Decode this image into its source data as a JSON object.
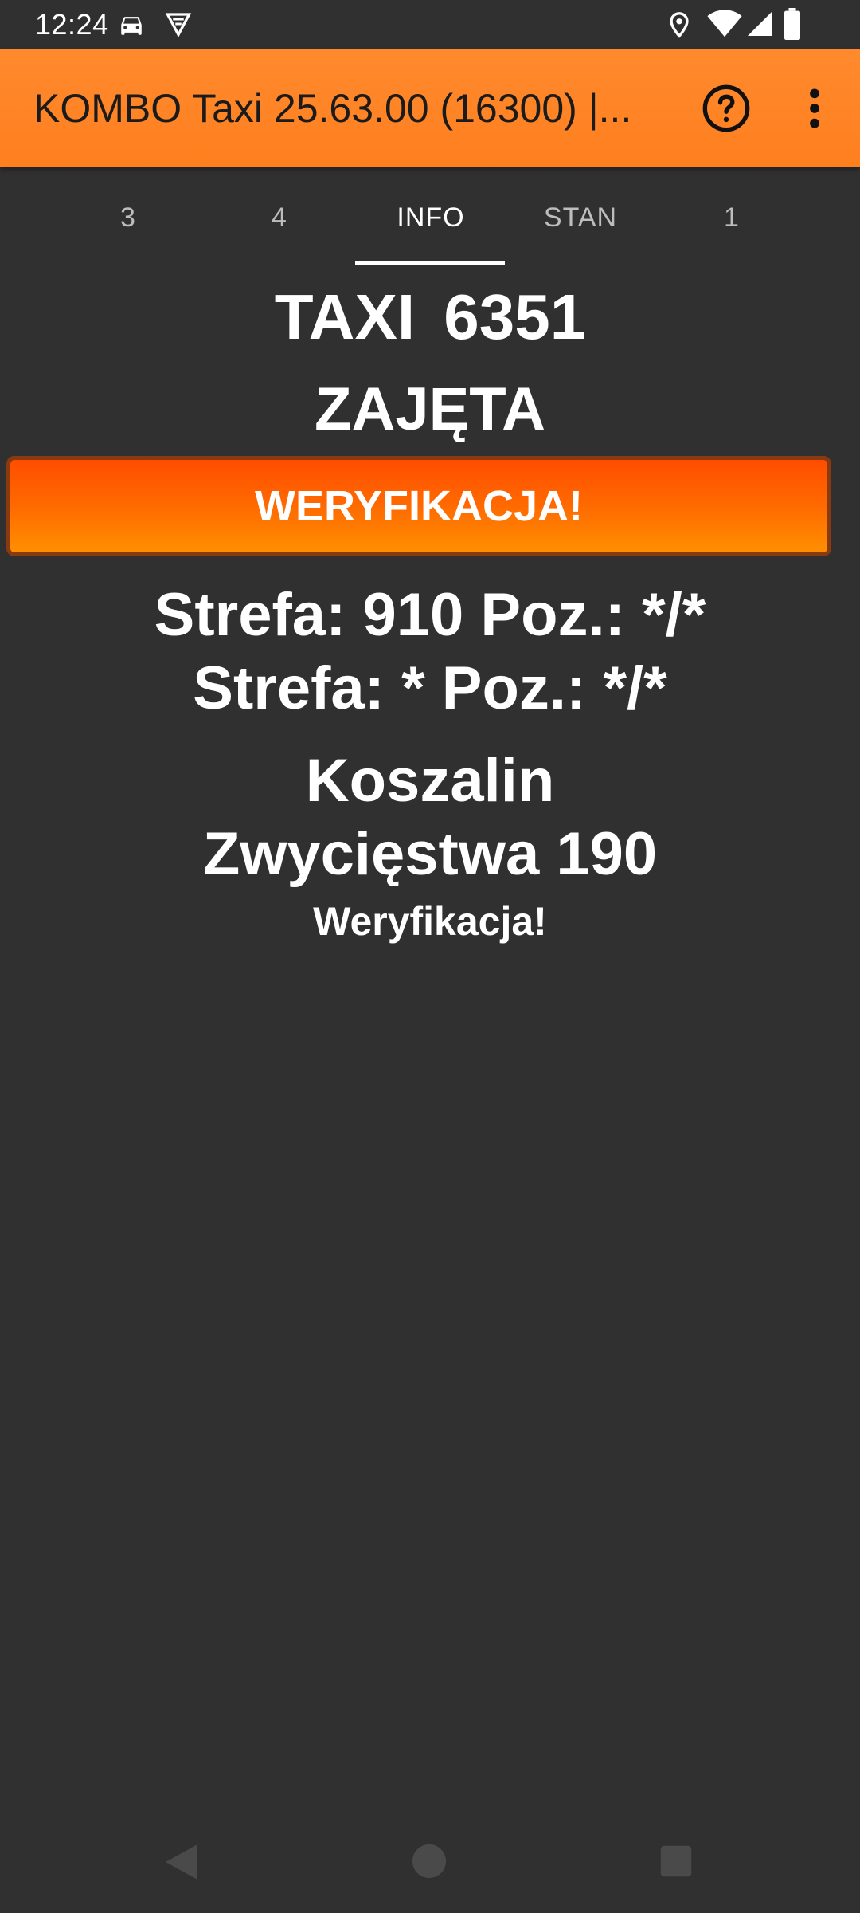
{
  "status_bar": {
    "time": "12:24",
    "left_icons": [
      "car-icon",
      "vpn-shield-icon"
    ],
    "right_icons": [
      "location-icon",
      "wifi-icon",
      "signal-icon",
      "battery-icon"
    ]
  },
  "app_bar": {
    "title": "KOMBO Taxi 25.63.00 (16300) |...",
    "help_icon": "help-circle-icon",
    "menu_icon": "more-vertical-icon",
    "color": "#ff8a2e"
  },
  "tabs": [
    {
      "label": "3",
      "active": false
    },
    {
      "label": "4",
      "active": false
    },
    {
      "label": "INFO",
      "active": true
    },
    {
      "label": "STAN",
      "active": false
    },
    {
      "label": "1",
      "active": false
    }
  ],
  "main": {
    "taxi_title": "TAXI 6351",
    "status": "ZAJĘTA",
    "verify_button_label": "WERYFIKACJA!",
    "verify_button_color": "#ff5a00",
    "zone_line_1": "Strefa: 910 Poz.: */*",
    "zone_line_2": "Strefa: * Poz.: */*",
    "city": "Koszalin",
    "street": "Zwycięstwa 190",
    "note": "Weryfikacja!"
  },
  "nav_bar": {
    "icons": [
      "back-icon",
      "home-icon",
      "recents-icon"
    ]
  },
  "colors": {
    "background": "#303030",
    "text": "#ffffff"
  }
}
